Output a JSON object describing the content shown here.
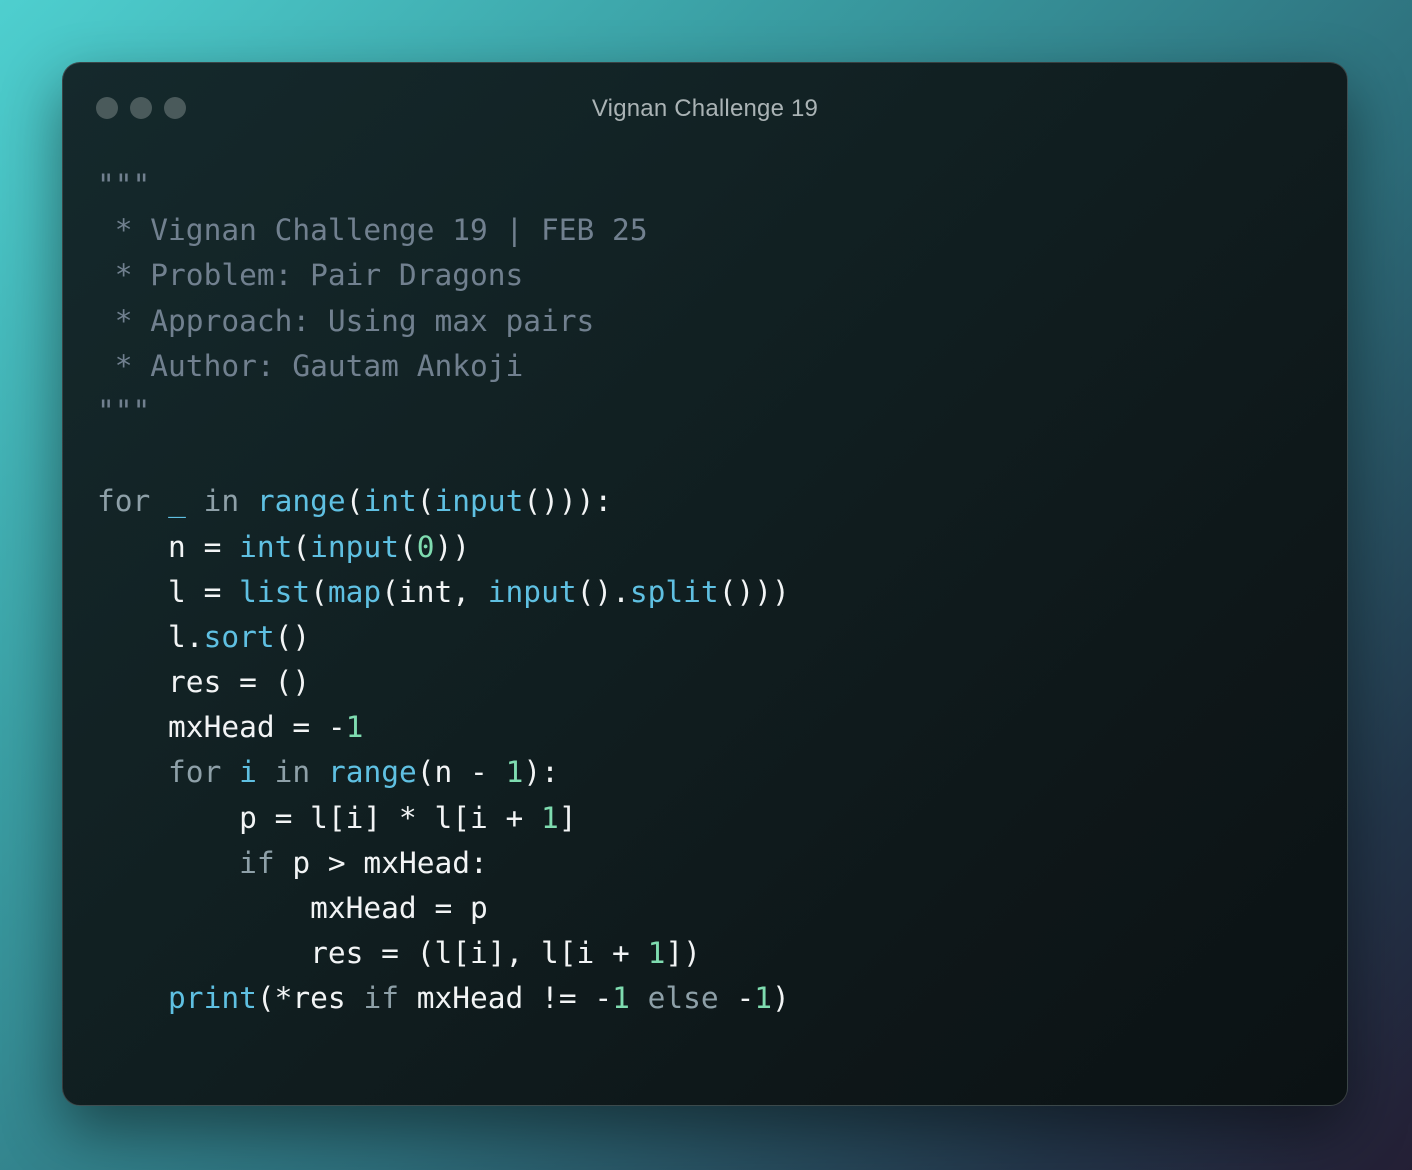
{
  "window": {
    "title": "Vignan Challenge 19"
  },
  "colors": {
    "comment": "#71808f",
    "keyword": "#8ea0a8",
    "function": "#5fc0e2",
    "number": "#7fdcb0",
    "text": "#f2f4f5"
  },
  "code": [
    [
      {
        "t": "\"\"\"",
        "c": "cm"
      }
    ],
    [
      {
        "t": " * Vignan Challenge 19 | FEB 25",
        "c": "cm"
      }
    ],
    [
      {
        "t": " * Problem: Pair Dragons",
        "c": "cm"
      }
    ],
    [
      {
        "t": " * Approach: Using max pairs",
        "c": "cm"
      }
    ],
    [
      {
        "t": " * Author: Gautam Ankoji",
        "c": "cm"
      }
    ],
    [
      {
        "t": "\"\"\"",
        "c": "cm"
      }
    ],
    [],
    [
      {
        "t": "for",
        "c": "kw"
      },
      {
        "t": " ",
        "c": "pl"
      },
      {
        "t": "_",
        "c": "fn"
      },
      {
        "t": " ",
        "c": "pl"
      },
      {
        "t": "in",
        "c": "kw"
      },
      {
        "t": " ",
        "c": "pl"
      },
      {
        "t": "range",
        "c": "fn"
      },
      {
        "t": "(",
        "c": "pl"
      },
      {
        "t": "int",
        "c": "fn"
      },
      {
        "t": "(",
        "c": "pl"
      },
      {
        "t": "input",
        "c": "fn"
      },
      {
        "t": "())):",
        "c": "pl"
      }
    ],
    [
      {
        "t": "    n = ",
        "c": "pl"
      },
      {
        "t": "int",
        "c": "fn"
      },
      {
        "t": "(",
        "c": "pl"
      },
      {
        "t": "input",
        "c": "fn"
      },
      {
        "t": "(",
        "c": "pl"
      },
      {
        "t": "0",
        "c": "num"
      },
      {
        "t": "))",
        "c": "pl"
      }
    ],
    [
      {
        "t": "    l = ",
        "c": "pl"
      },
      {
        "t": "list",
        "c": "fn"
      },
      {
        "t": "(",
        "c": "pl"
      },
      {
        "t": "map",
        "c": "fn"
      },
      {
        "t": "(int, ",
        "c": "pl"
      },
      {
        "t": "input",
        "c": "fn"
      },
      {
        "t": "().",
        "c": "pl"
      },
      {
        "t": "split",
        "c": "fn"
      },
      {
        "t": "()))",
        "c": "pl"
      }
    ],
    [
      {
        "t": "    l.",
        "c": "pl"
      },
      {
        "t": "sort",
        "c": "fn"
      },
      {
        "t": "()",
        "c": "pl"
      }
    ],
    [
      {
        "t": "    res = ()",
        "c": "pl"
      }
    ],
    [
      {
        "t": "    mxHead = -",
        "c": "pl"
      },
      {
        "t": "1",
        "c": "num"
      }
    ],
    [
      {
        "t": "    ",
        "c": "pl"
      },
      {
        "t": "for",
        "c": "kw"
      },
      {
        "t": " ",
        "c": "pl"
      },
      {
        "t": "i",
        "c": "fn"
      },
      {
        "t": " ",
        "c": "pl"
      },
      {
        "t": "in",
        "c": "kw"
      },
      {
        "t": " ",
        "c": "pl"
      },
      {
        "t": "range",
        "c": "fn"
      },
      {
        "t": "(n - ",
        "c": "pl"
      },
      {
        "t": "1",
        "c": "num"
      },
      {
        "t": "):",
        "c": "pl"
      }
    ],
    [
      {
        "t": "        p = l[i] * l[i + ",
        "c": "pl"
      },
      {
        "t": "1",
        "c": "num"
      },
      {
        "t": "]",
        "c": "pl"
      }
    ],
    [
      {
        "t": "        ",
        "c": "pl"
      },
      {
        "t": "if",
        "c": "kw"
      },
      {
        "t": " p > mxHead:",
        "c": "pl"
      }
    ],
    [
      {
        "t": "            mxHead = p",
        "c": "pl"
      }
    ],
    [
      {
        "t": "            res = (l[i], l[i + ",
        "c": "pl"
      },
      {
        "t": "1",
        "c": "num"
      },
      {
        "t": "])",
        "c": "pl"
      }
    ],
    [
      {
        "t": "    ",
        "c": "pl"
      },
      {
        "t": "print",
        "c": "fn"
      },
      {
        "t": "(*res ",
        "c": "pl"
      },
      {
        "t": "if",
        "c": "kw"
      },
      {
        "t": " mxHead != -",
        "c": "pl"
      },
      {
        "t": "1",
        "c": "num"
      },
      {
        "t": " ",
        "c": "pl"
      },
      {
        "t": "else",
        "c": "kw"
      },
      {
        "t": " -",
        "c": "pl"
      },
      {
        "t": "1",
        "c": "num"
      },
      {
        "t": ")",
        "c": "pl"
      }
    ]
  ]
}
